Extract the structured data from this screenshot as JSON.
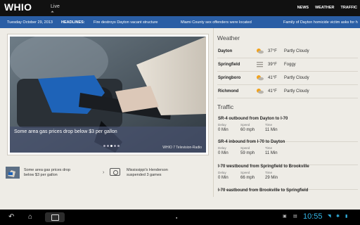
{
  "header": {
    "logo": "WHIO",
    "live_label": "Live",
    "nav": [
      "NEWS",
      "WEATHER",
      "TRAFFIC"
    ]
  },
  "ticker": {
    "date": "Tuesday October 29, 2013",
    "heading": "HEADLINES:",
    "items": [
      "Fire destroys Dayton vacant structure",
      "Miami County sex offenders were located",
      "Family of Dayton homicide victim asks for h"
    ]
  },
  "hero": {
    "title": "Some area gas prices drop below $3 per gallon",
    "credit": "WHIO 7 Television-Radio",
    "slides": 5,
    "active_slide": 3
  },
  "related": [
    {
      "text": "Some area gas prices drop below $3 per gallon"
    },
    {
      "text": "Mississippi's Henderson suspended 3 games"
    }
  ],
  "weather": {
    "title": "Weather",
    "items": [
      {
        "city": "Dayton",
        "temp": "37°F",
        "condition": "Partly Cloudy",
        "icon": "partly-cloudy-icon"
      },
      {
        "city": "Springfield",
        "temp": "39°F",
        "condition": "Foggy",
        "icon": "fog-icon"
      },
      {
        "city": "Springboro",
        "temp": "41°F",
        "condition": "Partly Cloudy",
        "icon": "partly-cloudy-icon"
      },
      {
        "city": "Richmond",
        "temp": "41°F",
        "condition": "Partly Cloudy",
        "icon": "partly-cloudy-icon"
      }
    ]
  },
  "traffic": {
    "title": "Traffic",
    "labels": {
      "delay": "Delay",
      "speed": "Speed",
      "time": "Time"
    },
    "routes": [
      {
        "name": "SR-4 outbound from Dayton to I-70",
        "delay": "0 Min",
        "speed": "60 mph",
        "time": "11 Min"
      },
      {
        "name": "SR-4 inbound from I-70 to Dayton",
        "delay": "0 Min",
        "speed": "59 mph",
        "time": "11 Min"
      },
      {
        "name": "I-70 westbound from Springfield to Brookville",
        "delay": "0 Min",
        "speed": "66 mph",
        "time": "29 Min"
      },
      {
        "name": "I-70 eastbound from Brookville to Springfield",
        "delay": "",
        "speed": "",
        "time": ""
      }
    ]
  },
  "system_bar": {
    "clock": "10:55",
    "accent": "#33b5e5"
  }
}
